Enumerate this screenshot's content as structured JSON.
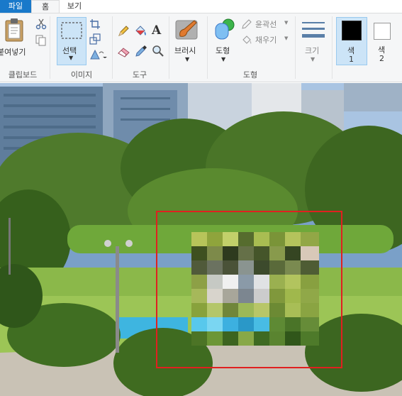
{
  "tabs": {
    "file": "파일",
    "home": "홈",
    "view": "보기"
  },
  "clipboard": {
    "paste_label": "붙여넣기",
    "group_label": "클립보드"
  },
  "image": {
    "select_label": "선택",
    "group_label": "이미지"
  },
  "tools": {
    "group_label": "도구"
  },
  "brushes": {
    "label": "브러시"
  },
  "shapes": {
    "shape_label": "도형",
    "outline_label": "윤곽선",
    "fill_label": "채우기",
    "group_label": "도형"
  },
  "size": {
    "label": "크기"
  },
  "colors": {
    "color1_label": "색\n1",
    "color1_line1": "색",
    "color1_line2": "1",
    "color2_line1": "색",
    "color2_line2": "2",
    "color1_value": "#000000",
    "color2_value": "#ffffff"
  },
  "canvas": {
    "selection_color": "#e02020"
  }
}
